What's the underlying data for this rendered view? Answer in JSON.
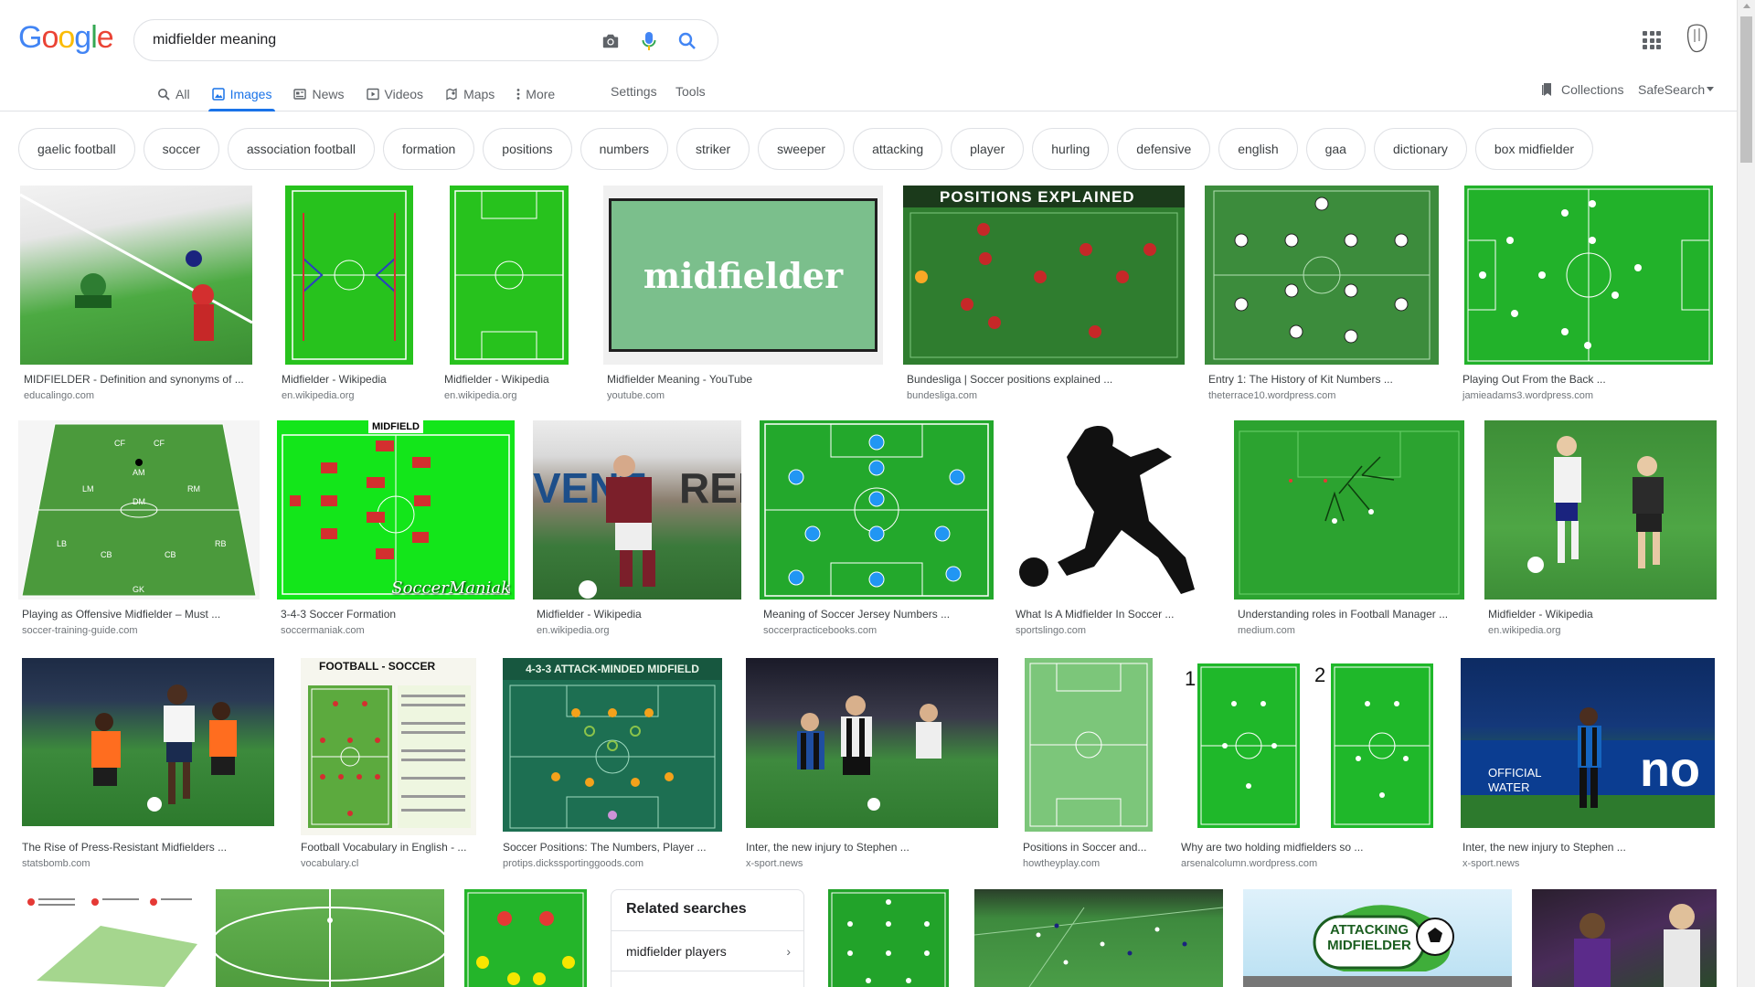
{
  "logo": {
    "text": "Google",
    "colors": [
      "#4285f4",
      "#ea4335",
      "#fbbc05",
      "#4285f4",
      "#34a853",
      "#ea4335"
    ]
  },
  "search": {
    "query": "midfielder meaning"
  },
  "tabs": [
    {
      "label": "All",
      "icon": "search-icon"
    },
    {
      "label": "Images",
      "icon": "image-icon",
      "active": true
    },
    {
      "label": "News",
      "icon": "news-icon"
    },
    {
      "label": "Videos",
      "icon": "video-icon"
    },
    {
      "label": "Maps",
      "icon": "map-pin-icon"
    },
    {
      "label": "More",
      "icon": "more-vert-icon"
    }
  ],
  "header_links": {
    "settings": "Settings",
    "tools": "Tools",
    "collections": "Collections",
    "safesearch": "SafeSearch"
  },
  "chips": [
    "gaelic football",
    "soccer",
    "association football",
    "formation",
    "positions",
    "numbers",
    "striker",
    "sweeper",
    "attacking",
    "player",
    "hurling",
    "defensive",
    "english",
    "gaa",
    "dictionary",
    "box midfielder"
  ],
  "results": {
    "row1": [
      {
        "title": "MIDFIELDER - Definition and synonyms of ...",
        "source": "educalingo.com"
      },
      {
        "title": "Midfielder - Wikipedia",
        "source": "en.wikipedia.org"
      },
      {
        "title": "Midfielder - Wikipedia",
        "source": "en.wikipedia.org"
      },
      {
        "title": "Midfielder Meaning - YouTube",
        "source": "youtube.com",
        "overlay": "midfielder"
      },
      {
        "title": "Bundesliga | Soccer positions explained ...",
        "source": "bundesliga.com",
        "overlay": "POSITIONS EXPLAINED"
      },
      {
        "title": "Entry 1: The History of Kit Numbers ...",
        "source": "theterrace10.wordpress.com"
      },
      {
        "title": "Playing Out From the Back ...",
        "source": "jamieadams3.wordpress.com"
      }
    ],
    "row2": [
      {
        "title": "Playing as Offensive Midfielder – Must ...",
        "source": "soccer-training-guide.com"
      },
      {
        "title": "3-4-3 Soccer Formation",
        "source": "soccermaniak.com",
        "overlay": "MIDFIELD",
        "overlay2": "SoccerManiak"
      },
      {
        "title": "Midfielder - Wikipedia",
        "source": "en.wikipedia.org"
      },
      {
        "title": "Meaning of Soccer Jersey Numbers ...",
        "source": "soccerpracticebooks.com"
      },
      {
        "title": "What Is A Midfielder In Soccer ...",
        "source": "sportslingo.com"
      },
      {
        "title": "Understanding roles in Football Manager ...",
        "source": "medium.com"
      },
      {
        "title": "Midfielder - Wikipedia",
        "source": "en.wikipedia.org"
      }
    ],
    "row3": [
      {
        "title": "The Rise of Press-Resistant Midfielders ...",
        "source": "statsbomb.com"
      },
      {
        "title": "Football Vocabulary in English - ...",
        "source": "vocabulary.cl",
        "overlay": "FOOTBALL - SOCCER"
      },
      {
        "title": "Soccer Positions: The Numbers, Player ...",
        "source": "protips.dickssportinggoods.com",
        "overlay": "4-3-3 ATTACK-MINDED MIDFIELD"
      },
      {
        "title": "Inter, the new injury to Stephen ...",
        "source": "x-sport.news"
      },
      {
        "title": "Positions in Soccer and...",
        "source": "howtheyplay.com"
      },
      {
        "title": "Why are two holding midfielders so ...",
        "source": "arsenalcolumn.wordpress.com"
      },
      {
        "title": "Inter, the new injury to Stephen ...",
        "source": "x-sport.news"
      }
    ]
  },
  "related": {
    "title": "Related searches",
    "items": [
      "midfielder players"
    ]
  },
  "row4_overlay": "ATTACKING MIDFIELDER"
}
